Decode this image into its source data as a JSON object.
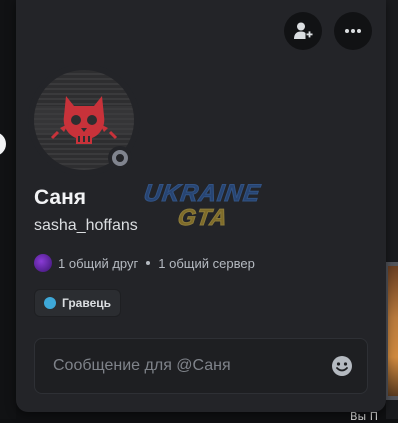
{
  "profile": {
    "display_name": "Саня",
    "username": "sasha_hoffans",
    "status": "offline"
  },
  "mutual": {
    "friends": "1 общий друг",
    "servers": "1 общий сервер"
  },
  "roles": [
    {
      "label": "Гравець",
      "color": "#3ea8d8"
    }
  ],
  "message": {
    "placeholder": "Сообщение для @Саня",
    "value": ""
  },
  "watermark": {
    "line1": "UKRAINE",
    "line2": "GTA"
  },
  "background": {
    "partial_text": "Вы П"
  },
  "icons": {
    "add_friend": "add-friend-icon",
    "more": "more-dots-icon",
    "emoji": "emoji-smile-icon",
    "avatar": "red-cat-skull-avatar"
  },
  "colors": {
    "card_bg": "#232428",
    "button_bg": "#111214",
    "input_bg": "#1e1f22",
    "offline": "#80848e",
    "role_dot": "#3ea8d8"
  }
}
